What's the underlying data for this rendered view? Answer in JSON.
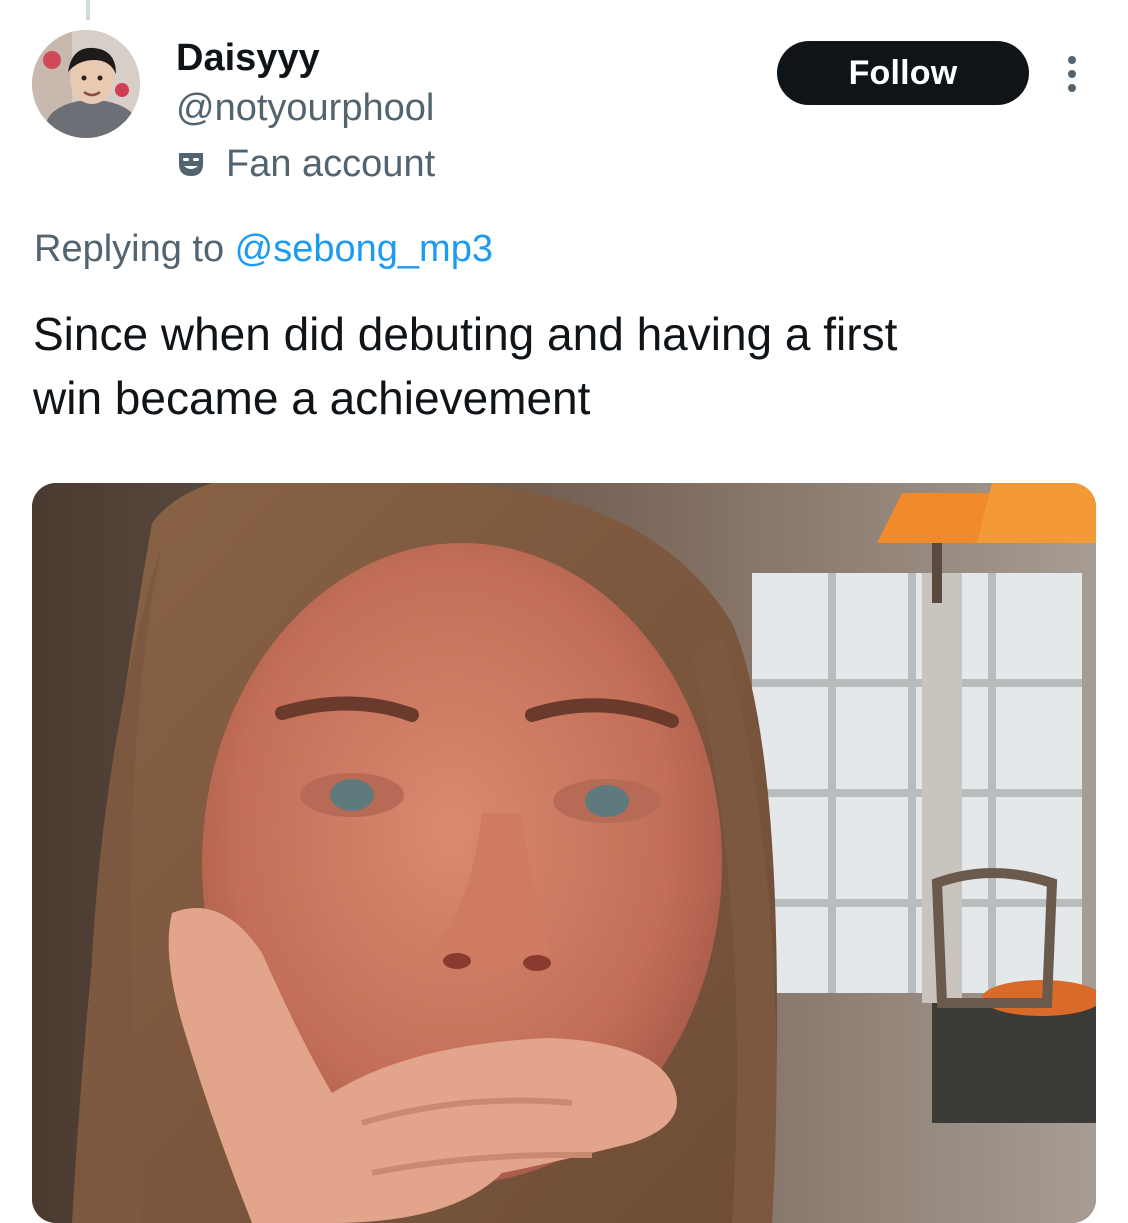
{
  "tweet": {
    "author": {
      "display_name": "Daisyyy",
      "handle": "@notyourphool",
      "account_label": "Fan account",
      "label_icon": "theater-mask-icon",
      "avatar_icon": "profile-photo"
    },
    "follow_label": "Follow",
    "more_icon": "more-vertical-icon",
    "reply_prefix": "Replying to ",
    "reply_to": "@sebong_mp3",
    "text": "Since when did debuting and having a first\nwin became a achievement",
    "media": {
      "kind": "photo",
      "icon": "reaction-photo"
    }
  },
  "colors": {
    "text_primary": "#0f1419",
    "text_secondary": "#536471",
    "accent": "#1d9bf0",
    "button_bg": "#0f1419",
    "button_text": "#ffffff"
  }
}
